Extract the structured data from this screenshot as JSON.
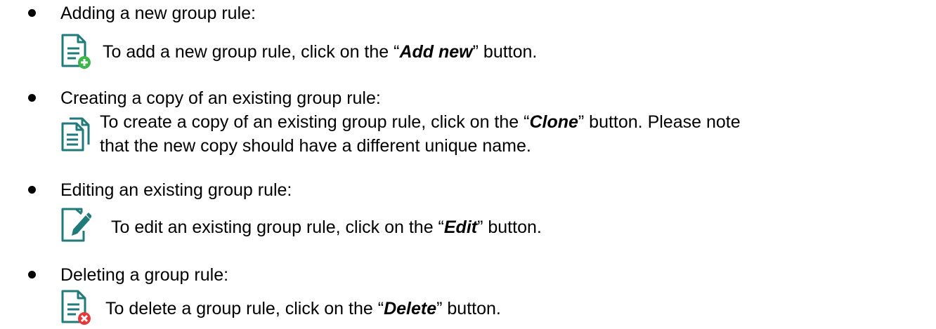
{
  "colors": {
    "icon_teal": "#1f7a78",
    "add_badge": "#3db54a",
    "delete_badge": "#e5383b"
  },
  "items": [
    {
      "heading": "Adding a new group rule:",
      "icon": "add-document-icon",
      "desc_before": "To add a new group rule, click on the “",
      "button": "Add new",
      "desc_after": "” button."
    },
    {
      "heading": "Creating a copy of an existing group rule:",
      "icon": "clone-document-icon",
      "desc_before": "To create a copy of an existing group rule, click on the “",
      "button": "Clone",
      "desc_after": "” button. Please note",
      "desc_line2": "that the new copy should have a different unique name."
    },
    {
      "heading": "Editing an existing group rule:",
      "icon": "edit-document-icon",
      "desc_before": "To edit an existing group rule, click on the “",
      "button": "Edit",
      "desc_after": "” button."
    },
    {
      "heading": "Deleting a group rule:",
      "icon": "delete-document-icon",
      "desc_before": "To delete a group rule, click on the “",
      "button": "Delete",
      "desc_after": "” button."
    }
  ]
}
